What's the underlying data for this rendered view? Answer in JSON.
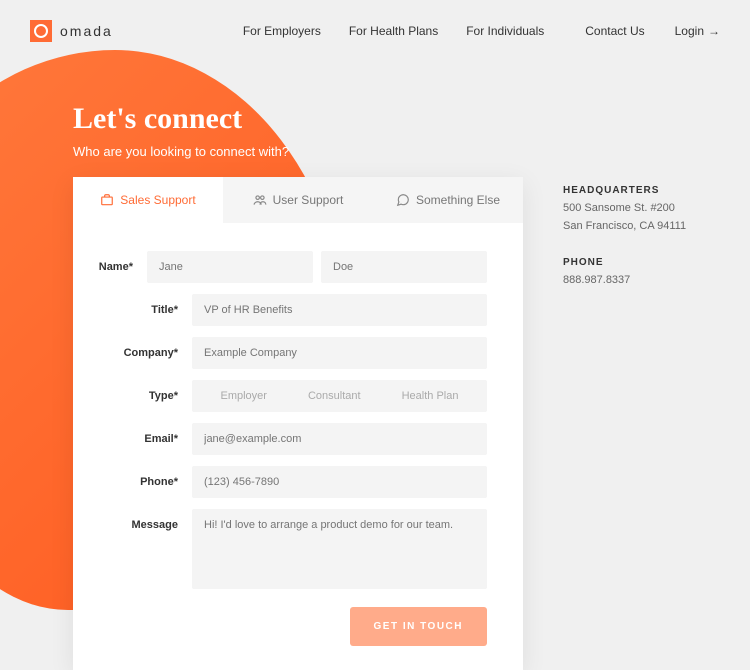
{
  "brand": {
    "name": "omada"
  },
  "nav": {
    "items": [
      {
        "label": "For Employers"
      },
      {
        "label": "For Health Plans"
      },
      {
        "label": "For Individuals"
      }
    ],
    "contact": "Contact Us",
    "login": "Login",
    "login_arrow": "→"
  },
  "hero": {
    "title": "Let's connect",
    "subtitle": "Who are you looking to connect with?"
  },
  "tabs": [
    {
      "label": "Sales Support"
    },
    {
      "label": "User Support"
    },
    {
      "label": "Something Else"
    }
  ],
  "form": {
    "name_label": "Name*",
    "first_name_placeholder": "Jane",
    "last_name_placeholder": "Doe",
    "title_label": "Title*",
    "title_placeholder": "VP of HR Benefits",
    "company_label": "Company*",
    "company_placeholder": "Example Company",
    "type_label": "Type*",
    "type_options": [
      "Employer",
      "Consultant",
      "Health Plan"
    ],
    "email_label": "Email*",
    "email_placeholder": "jane@example.com",
    "phone_label": "Phone*",
    "phone_placeholder": "(123) 456-7890",
    "message_label": "Message",
    "message_placeholder": "Hi! I'd love to arrange a product demo for our team.",
    "submit_label": "GET IN TOUCH"
  },
  "info": {
    "hq_title": "HEADQUARTERS",
    "hq_line1": "500 Sansome St. #200",
    "hq_line2": "San Francisco, CA 94111",
    "phone_title": "PHONE",
    "phone_value": "888.987.8337"
  }
}
